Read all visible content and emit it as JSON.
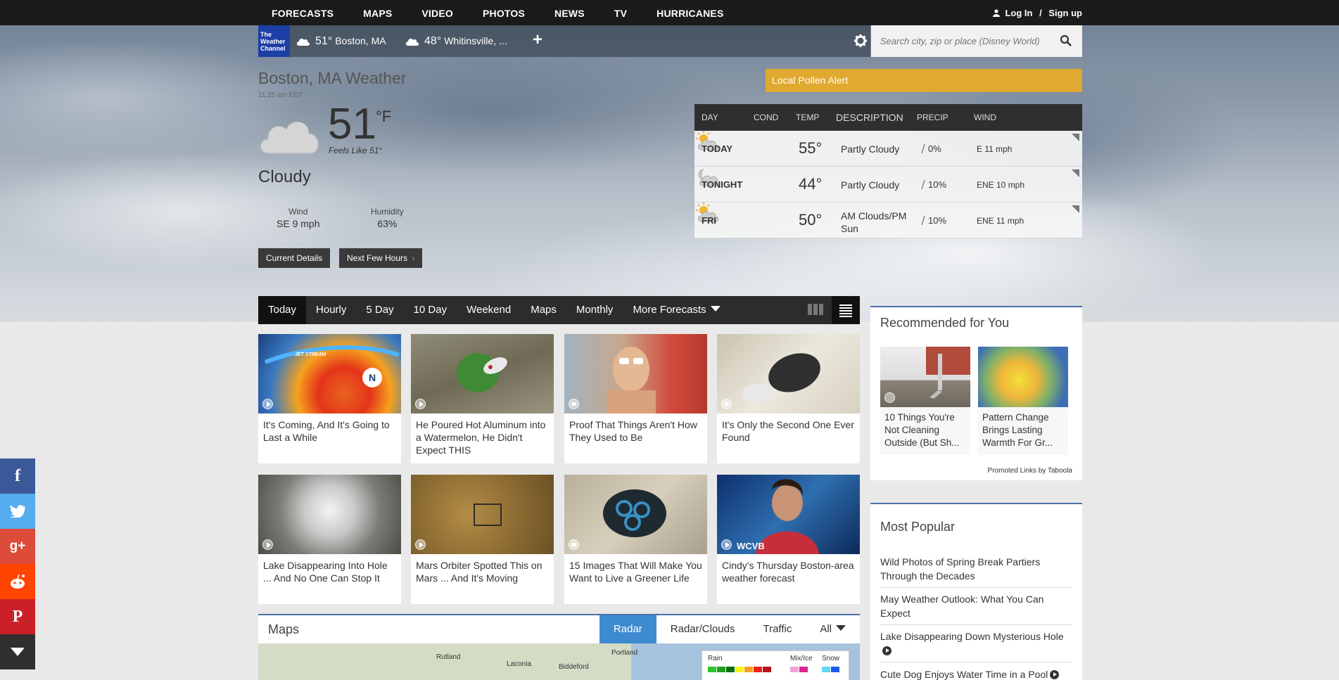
{
  "nav": {
    "items": [
      "FORECASTS",
      "MAPS",
      "VIDEO",
      "PHOTOS",
      "NEWS",
      "TV",
      "HURRICANES"
    ],
    "login": "Log In",
    "separator": "/",
    "signup": "Sign up"
  },
  "locations": {
    "logo_line1": "The",
    "logo_line2": "Weather",
    "logo_line3": "Channel",
    "items": [
      {
        "temp": "51°",
        "name": "Boston, MA"
      },
      {
        "temp": "48°",
        "name": "Whitinsville, ..."
      }
    ],
    "add": "+"
  },
  "search": {
    "placeholder": "Search city, zip or place (Disney World)"
  },
  "current": {
    "city": "Boston, MA Weather",
    "time": "11:25 am EDT",
    "temp": "51",
    "unit": "°F",
    "feels_like": "Feels Like 51°",
    "phrase": "Cloudy",
    "wind_label": "Wind",
    "wind_value": "SE 9 mph",
    "humidity_label": "Humidity",
    "humidity_value": "63%",
    "btn_details": "Current Details",
    "btn_hours": "Next Few Hours",
    "chevron": "›"
  },
  "pollen": "Local Pollen Alert",
  "forecast": {
    "headers": {
      "day": "DAY",
      "cond": "COND",
      "temp": "TEMP",
      "desc": "DESCRIPTION",
      "precip": "PRECIP",
      "wind": "WIND"
    },
    "rows": [
      {
        "day": "TODAY",
        "temp": "55°",
        "desc": "Partly Cloudy",
        "precip": "0%",
        "wind": "E 11 mph"
      },
      {
        "day": "TONIGHT",
        "temp": "44°",
        "desc": "Partly Cloudy",
        "precip": "10%",
        "wind": "ENE 10 mph"
      },
      {
        "day": "FRI",
        "temp": "50°",
        "desc": "AM Clouds/PM Sun",
        "precip": "10%",
        "wind": "ENE 11 mph"
      }
    ]
  },
  "tabs": [
    "Today",
    "Hourly",
    "5 Day",
    "10 Day",
    "Weekend",
    "Maps",
    "Monthly",
    "More Forecasts"
  ],
  "cards": [
    {
      "caption": "It's Coming, And It's Going to Last a While"
    },
    {
      "caption": "He Poured Hot Aluminum into a Watermelon, He Didn't Expect THIS"
    },
    {
      "caption": "Proof That Things Aren't How They Used to Be"
    },
    {
      "caption": "It's Only the Second One Ever Found"
    },
    {
      "caption": "Lake Disappearing Into Hole ... And No One Can Stop It"
    },
    {
      "caption": "Mars Orbiter Spotted This on Mars ... And It's Moving"
    },
    {
      "caption": "15 Images That Will Make You Want to Live a Greener Life"
    },
    {
      "caption": "Cindy's Thursday Boston-area weather forecast"
    }
  ],
  "card_overlays": {
    "jet_stream": "JET STREAM",
    "wcvb": "WCVB"
  },
  "maps": {
    "title": "Maps",
    "tabs": [
      "Radar",
      "Radar/Clouds",
      "Traffic",
      "All"
    ],
    "places": [
      "Rutland",
      "Laconia",
      "Biddeford",
      "Portland"
    ],
    "legend": {
      "rain": "Rain",
      "mix": "Mix/Ice",
      "snow": "Snow"
    }
  },
  "recommended": {
    "title": "Recommended for You",
    "items": [
      {
        "caption": "10 Things You're Not Cleaning Outside (But Sh..."
      },
      {
        "caption": "Pattern Change Brings Lasting Warmth For Gr..."
      }
    ],
    "promo": "Promoted Links by Taboola"
  },
  "popular": {
    "title": "Most Popular",
    "items": [
      "Wild Photos of Spring Break Partiers Through the Decades",
      "May Weather Outlook: What You Can Expect",
      "Lake Disappearing Down Mysterious Hole",
      "Cute Dog Enjoys Water Time in a Pool"
    ]
  },
  "social": [
    "f",
    "twitter",
    "g+",
    "reddit",
    "P",
    "more"
  ],
  "colors": {
    "accent_blue": "#3d8ad1",
    "pollen": "#e0a92f",
    "logo_blue": "#1c3fa7"
  }
}
